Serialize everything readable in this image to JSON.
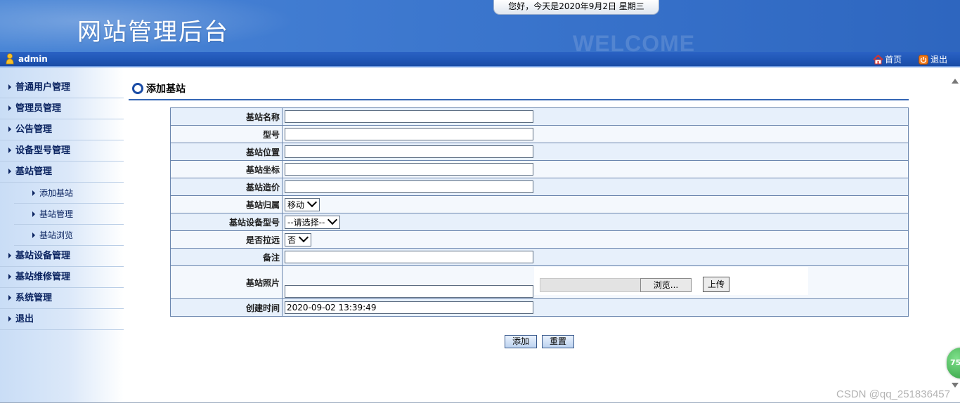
{
  "header": {
    "site_title": "网站管理后台",
    "watermark": "WELCOME",
    "date_text": "您好，今天是2020年9月2日 星期三"
  },
  "userbar": {
    "username": "admin",
    "home_label": "首页",
    "logout_label": "退出"
  },
  "sidebar": {
    "items": [
      {
        "label": "普通用户管理"
      },
      {
        "label": "管理员管理"
      },
      {
        "label": "公告管理"
      },
      {
        "label": "设备型号管理"
      },
      {
        "label": "基站管理"
      },
      {
        "label": "基站设备管理"
      },
      {
        "label": "基站维修管理"
      },
      {
        "label": "系统管理"
      },
      {
        "label": "退出"
      }
    ],
    "sub_items": [
      {
        "label": "添加基站"
      },
      {
        "label": "基站管理"
      },
      {
        "label": "基站浏览"
      }
    ]
  },
  "page": {
    "title": "添加基站"
  },
  "form": {
    "name_label": "基站名称",
    "name_value": "",
    "model_label": "型号",
    "model_value": "",
    "location_label": "基站位置",
    "location_value": "",
    "coords_label": "基站坐标",
    "coords_value": "",
    "cost_label": "基站造价",
    "cost_value": "",
    "owner_label": "基站归属",
    "owner_selected": "移动",
    "device_model_label": "基站设备型号",
    "device_model_selected": "--请选择--",
    "remote_label": "是否拉远",
    "remote_selected": "否",
    "remark_label": "备注",
    "remark_value": "",
    "photo_label": "基站照片",
    "photo_value": "",
    "browse_label": "浏览...",
    "upload_label": "上传",
    "created_label": "创建时间",
    "created_value": "2020-09-02 13:39:49"
  },
  "actions": {
    "add_label": "添加",
    "reset_label": "重置"
  },
  "misc": {
    "badge_text": "75",
    "csdn_watermark": "CSDN @qq_251836457"
  },
  "colors": {
    "header_blue": "#3f7ad0",
    "userbar_blue": "#1f55b4",
    "table_border": "#6b86ae",
    "row_light": "#e7f0fb"
  }
}
